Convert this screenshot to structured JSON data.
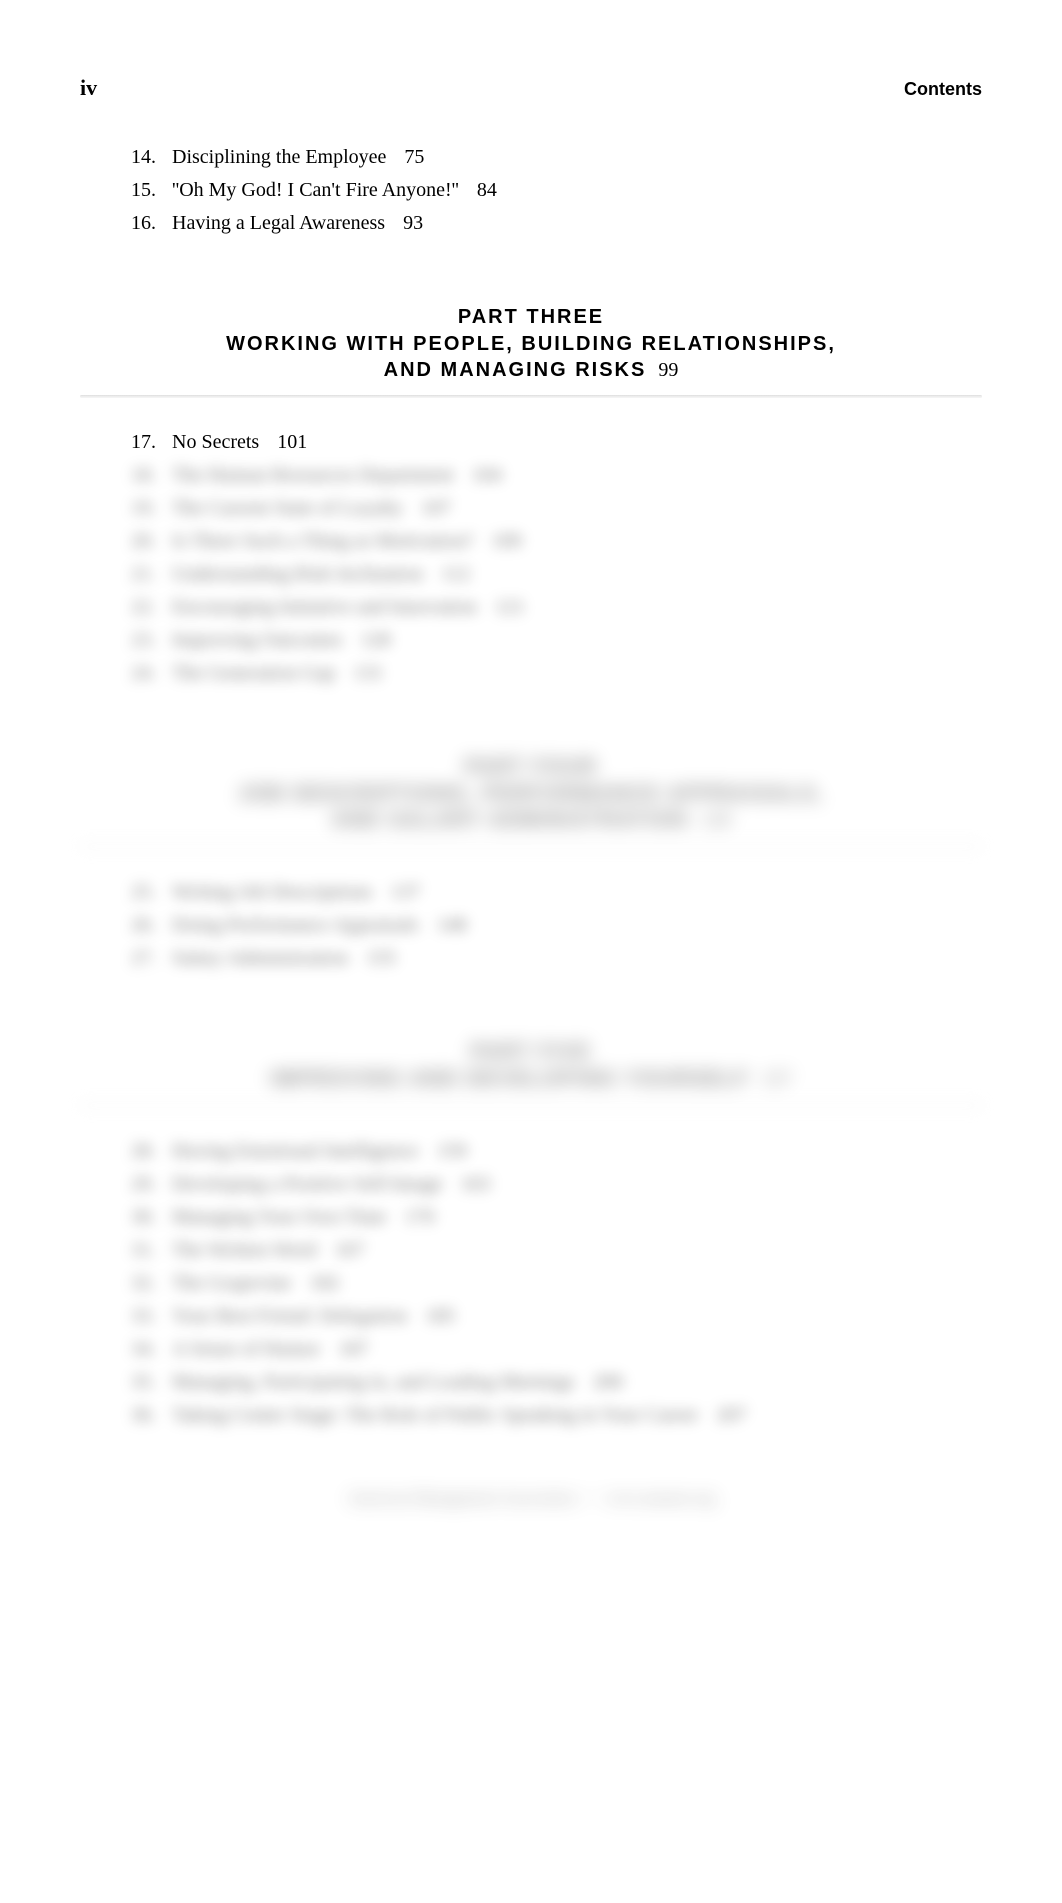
{
  "header": {
    "pageRoman": "iv",
    "label": "Contents"
  },
  "topEntries": [
    {
      "num": "14.",
      "title": "Disciplining the Employee",
      "page": "75"
    },
    {
      "num": "15.",
      "title": "''Oh My God! I Can't Fire Anyone!''",
      "page": "84"
    },
    {
      "num": "16.",
      "title": "Having a Legal Awareness",
      "page": "93"
    }
  ],
  "parts": [
    {
      "label": "PART  THREE",
      "titleLines": [
        "WORKING  WITH  PEOPLE,  BUILDING  RELATIONSHIPS,",
        "AND  MANAGING  RISKS"
      ],
      "page": "99",
      "entries": [
        {
          "num": "17.",
          "title": "No Secrets",
          "page": "101",
          "blurred": false
        },
        {
          "num": "18.",
          "title": "The Human Resources Department",
          "page": "104",
          "blurred": true
        },
        {
          "num": "19.",
          "title": "The Current State of Loyalty",
          "page": "107",
          "blurred": true
        },
        {
          "num": "20.",
          "title": "Is There Such a Thing as Motivation?",
          "page": "109",
          "blurred": true
        },
        {
          "num": "21.",
          "title": "Understanding Risk Inclination",
          "page": "112",
          "blurred": true
        },
        {
          "num": "22.",
          "title": "Encouraging Initiative and Innovation",
          "page": "121",
          "blurred": true
        },
        {
          "num": "23.",
          "title": "Improving Outcomes",
          "page": "128",
          "blurred": true
        },
        {
          "num": "24.",
          "title": "The Generation Gap",
          "page": "131",
          "blurred": true
        }
      ]
    },
    {
      "label": "PART  FOUR",
      "titleLines": [
        "JOB  DESCRIPTIONS,  PERFORMANCE  APPRAISALS,",
        "AND  SALARY  ADMINISTRATION"
      ],
      "page": "139",
      "blurredHeading": true,
      "entries": [
        {
          "num": "25.",
          "title": "Writing Job Descriptions",
          "page": "137",
          "blurred": true
        },
        {
          "num": "26.",
          "title": "Doing Performance Appraisals",
          "page": "148",
          "blurred": true
        },
        {
          "num": "27.",
          "title": "Salary Administration",
          "page": "155",
          "blurred": true
        }
      ]
    },
    {
      "label": "PART  FIVE",
      "titleLines": [
        "IMPROVING  AND  DEVELOPING  YOURSELF"
      ],
      "page": "157",
      "blurredHeading": true,
      "entries": [
        {
          "num": "28.",
          "title": "Having Emotional Intelligence",
          "page": "159",
          "blurred": true
        },
        {
          "num": "29.",
          "title": "Developing a Positive Self-Image",
          "page": "163",
          "blurred": true
        },
        {
          "num": "30.",
          "title": "Managing Your Own Time",
          "page": "170",
          "blurred": true
        },
        {
          "num": "31.",
          "title": "The Written Word",
          "page": "167",
          "blurred": true
        },
        {
          "num": "32.",
          "title": "The Grapevine",
          "page": "182",
          "blurred": true
        },
        {
          "num": "33.",
          "title": "Your Best Friend: Delegation",
          "page": "185",
          "blurred": true
        },
        {
          "num": "34.",
          "title": "A Sense of Humor",
          "page": "187",
          "blurred": true
        },
        {
          "num": "35.",
          "title": "Managing, Participating in, and Leading Meetings",
          "page": "200",
          "blurred": true
        },
        {
          "num": "36.",
          "title": "Taking Center Stage: The Role of Public Speaking in Your Career",
          "page": "207",
          "blurred": true
        }
      ]
    }
  ],
  "footer": {
    "left": "American Management Association",
    "right": "www.amanet.org"
  }
}
